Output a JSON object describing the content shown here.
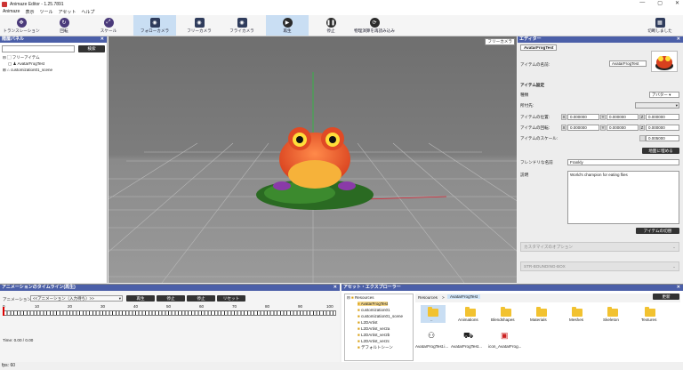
{
  "window": {
    "title": "Animaze Editor - 1.25.7891",
    "controls": [
      "—",
      "▢",
      "✕"
    ]
  },
  "menu": [
    "Animaze",
    "表示",
    "ツール",
    "アセット",
    "ヘルプ"
  ],
  "toolbar": {
    "buttons": [
      {
        "label": "トランスレーション",
        "icon": "translate-icon"
      },
      {
        "label": "回転",
        "icon": "rotate-icon"
      },
      {
        "label": "スケール",
        "icon": "scale-icon"
      },
      {
        "label": "フォローカメラ",
        "icon": "follow-camera-icon"
      },
      {
        "label": "フリーカメラ",
        "icon": "free-camera-icon"
      },
      {
        "label": "フライカメラ",
        "icon": "fly-camera-icon"
      },
      {
        "label": "再生",
        "icon": "play-icon"
      },
      {
        "label": "停止",
        "icon": "stop-icon"
      },
      {
        "label": "物理演算を再読み込み",
        "icon": "reload-icon"
      },
      {
        "label": "切断しました",
        "icon": "disconnect-icon"
      }
    ]
  },
  "hierarchy": {
    "title": "階層パネル",
    "search_button": "検索",
    "items": [
      "フリーアイテム",
      "AvatarFrogTest",
      "customization01_scene"
    ]
  },
  "viewport": {
    "camera_label": "フリーカメラ"
  },
  "editor": {
    "title": "エディター",
    "tab": "AvatarFrogTest",
    "item_name_label": "アイテムの名前:",
    "item_name_value": "AvatarFrogTest",
    "settings_header": "アイテム設定",
    "type_label": "種類",
    "type_value": "アバター",
    "parent_label": "所付先:",
    "pos_label": "アイテムの位置:",
    "rot_label": "アイテムの回転:",
    "scale_label": "アイテムのスケール:",
    "pos": [
      "0.000000",
      "0.000000",
      "0.000000"
    ],
    "rot": [
      "0.000000",
      "0.000000",
      "0.000000"
    ],
    "scale": "0.005000",
    "ground_button": "地面に埋める",
    "friendly_label": "フレンドリな名前",
    "friendly_value": "Frankly",
    "desc_label": "説明",
    "desc_value": "World's champion for eating flies",
    "switch_button": "アイテムの切替",
    "customize_section": "カスタマイズのオプション",
    "bbox_section": "STR-BOUNDING-BOX"
  },
  "timeline": {
    "title": "アニメーションのタイムライン(再生)",
    "anim_label": "アニメーション:",
    "anim_value": "<<アニメーション（入力待ち）>>",
    "buttons": [
      "再生",
      "停止",
      "停止",
      "リセット"
    ],
    "ticks": [
      "0",
      "10",
      "20",
      "30",
      "40",
      "50",
      "60",
      "70",
      "80",
      "90",
      "100"
    ],
    "time": "Time: 0.00 / 0.00"
  },
  "assets": {
    "title": "アセット・エクスプローラー",
    "tree_root": "Resources",
    "tree": [
      "AvatarFrogTest",
      "customization01",
      "customization01_scene",
      "L2DArtist",
      "L2DArtist_ver2a",
      "L2DArtist_ver2b",
      "L2DArtist_ver2c",
      "デフォルトシーン"
    ],
    "breadcrumb": [
      "Resources",
      ">",
      "AvatarFrogTest"
    ],
    "refresh_button": "更新",
    "folders": [
      "..",
      "Animations",
      "Blendshapes",
      "Materials",
      "Meshes",
      "Skeleton",
      "Textures"
    ],
    "files": [
      "AvatarFrogTest.i...",
      "AvatarFrogTest...",
      "icon_AvatarFrog..."
    ]
  },
  "status": "fps: 60",
  "colors": {
    "panel_title": "#4b5fa8",
    "active_toolbar": "#c9def3",
    "accent": "#3a5bc7"
  }
}
